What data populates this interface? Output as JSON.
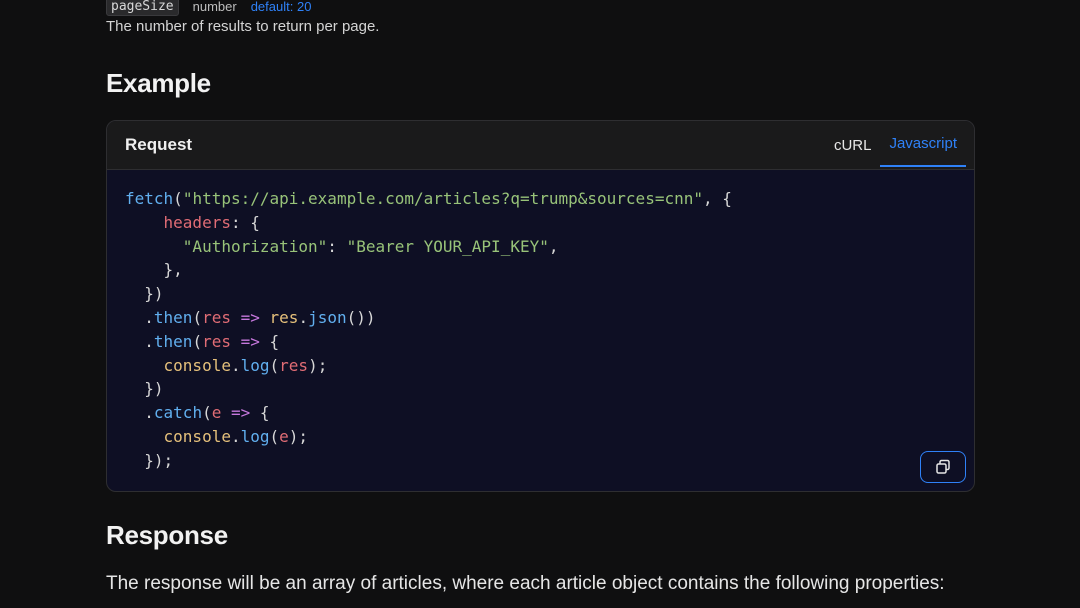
{
  "param": {
    "name": "pageSize",
    "type": "number",
    "default": "default: 20",
    "description": "The number of results to return per page."
  },
  "example_heading": "Example",
  "request_card": {
    "title": "Request",
    "tabs": [
      {
        "label": "cURL",
        "active": false
      },
      {
        "label": "Javascript",
        "active": true
      }
    ],
    "code_language": "javascript",
    "copy_icon": "copy-icon"
  },
  "code": {
    "url": "\"https://api.example.com/articles?q=trump&sources=cnn\"",
    "header_key": "\"Authorization\"",
    "header_value": "\"Bearer YOUR_API_KEY\""
  },
  "response_heading": "Response",
  "response_text": "The response will be an array of articles, where each article object contains the following properties:",
  "colors": {
    "background": "#0f0f10",
    "accent": "#2f81f7",
    "code_background": "#0e0f24"
  }
}
